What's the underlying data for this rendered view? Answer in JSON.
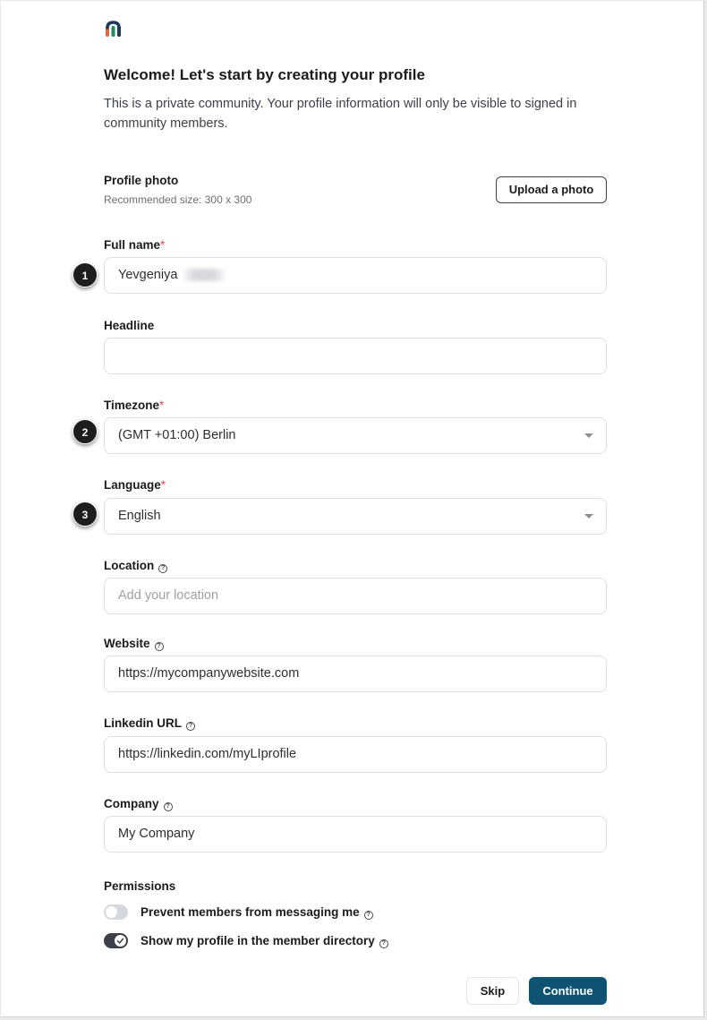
{
  "logo": {
    "icon": "community-logo-icon",
    "colors": [
      "#e8673a",
      "#1f8b5c",
      "#1c3a5a"
    ]
  },
  "header": {
    "title": "Welcome! Let's start by creating your profile",
    "subtitle": "This is a private community. Your profile information will only be visible to signed in community members."
  },
  "profile_photo": {
    "label": "Profile photo",
    "hint": "Recommended size: 300 x 300",
    "button_label": "Upload a photo"
  },
  "fields": {
    "full_name": {
      "label": "Full name",
      "required_mark": "*",
      "value": "Yevgeniya",
      "step": "1"
    },
    "headline": {
      "label": "Headline",
      "value": ""
    },
    "timezone": {
      "label": "Timezone",
      "required_mark": "*",
      "value": "(GMT +01:00) Berlin",
      "step": "2"
    },
    "language": {
      "label": "Language",
      "required_mark": "*",
      "value": "English",
      "step": "3"
    },
    "location": {
      "label": "Location",
      "placeholder": "Add your location",
      "help_icon": "?"
    },
    "website": {
      "label": "Website",
      "value": "https://mycompanywebsite.com",
      "help_icon": "?"
    },
    "linkedin": {
      "label": "Linkedin URL",
      "value": "https://linkedin.com/myLIprofile",
      "help_icon": "?"
    },
    "company": {
      "label": "Company",
      "value": "My Company",
      "help_icon": "?"
    }
  },
  "permissions": {
    "title": "Permissions",
    "items": [
      {
        "label": "Prevent members from messaging me",
        "enabled": false
      },
      {
        "label": "Show my profile in the member directory",
        "enabled": true
      }
    ]
  },
  "actions": {
    "skip_label": "Skip",
    "continue_label": "Continue"
  },
  "colors": {
    "primary": "#0e5371",
    "required": "#e5484d",
    "toggle_on": "#3c4048",
    "toggle_off": "#d5d8dc"
  }
}
